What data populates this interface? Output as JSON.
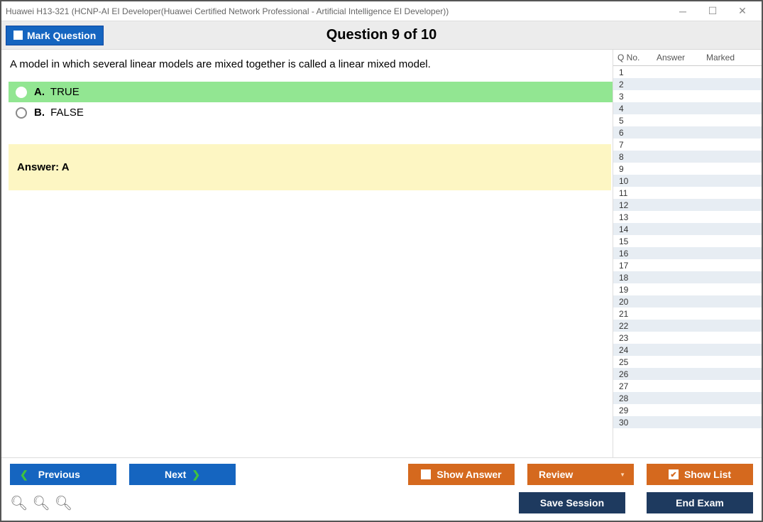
{
  "window": {
    "title": "Huawei H13-321 (HCNP-AI EI Developer(Huawei Certified Network Professional - Artificial Intelligence EI Developer))"
  },
  "header": {
    "mark_label": "Mark Question",
    "question_title": "Question 9 of 10"
  },
  "question": {
    "text": "A model in which several linear models are mixed together is called a linear mixed model.",
    "options": [
      {
        "letter": "A.",
        "text": "TRUE",
        "correct": true
      },
      {
        "letter": "B.",
        "text": "FALSE",
        "correct": false
      }
    ],
    "answer_label": "Answer: A"
  },
  "side": {
    "headers": {
      "qno": "Q No.",
      "answer": "Answer",
      "marked": "Marked"
    },
    "rows": [
      {
        "n": "1"
      },
      {
        "n": "2"
      },
      {
        "n": "3"
      },
      {
        "n": "4"
      },
      {
        "n": "5"
      },
      {
        "n": "6"
      },
      {
        "n": "7"
      },
      {
        "n": "8"
      },
      {
        "n": "9"
      },
      {
        "n": "10"
      },
      {
        "n": "11"
      },
      {
        "n": "12"
      },
      {
        "n": "13"
      },
      {
        "n": "14"
      },
      {
        "n": "15"
      },
      {
        "n": "16"
      },
      {
        "n": "17"
      },
      {
        "n": "18"
      },
      {
        "n": "19"
      },
      {
        "n": "20"
      },
      {
        "n": "21"
      },
      {
        "n": "22"
      },
      {
        "n": "23"
      },
      {
        "n": "24"
      },
      {
        "n": "25"
      },
      {
        "n": "26"
      },
      {
        "n": "27"
      },
      {
        "n": "28"
      },
      {
        "n": "29"
      },
      {
        "n": "30"
      }
    ]
  },
  "footer": {
    "previous": "Previous",
    "next": "Next",
    "show_answer": "Show Answer",
    "review": "Review",
    "show_list": "Show List",
    "save_session": "Save Session",
    "end_exam": "End Exam"
  }
}
